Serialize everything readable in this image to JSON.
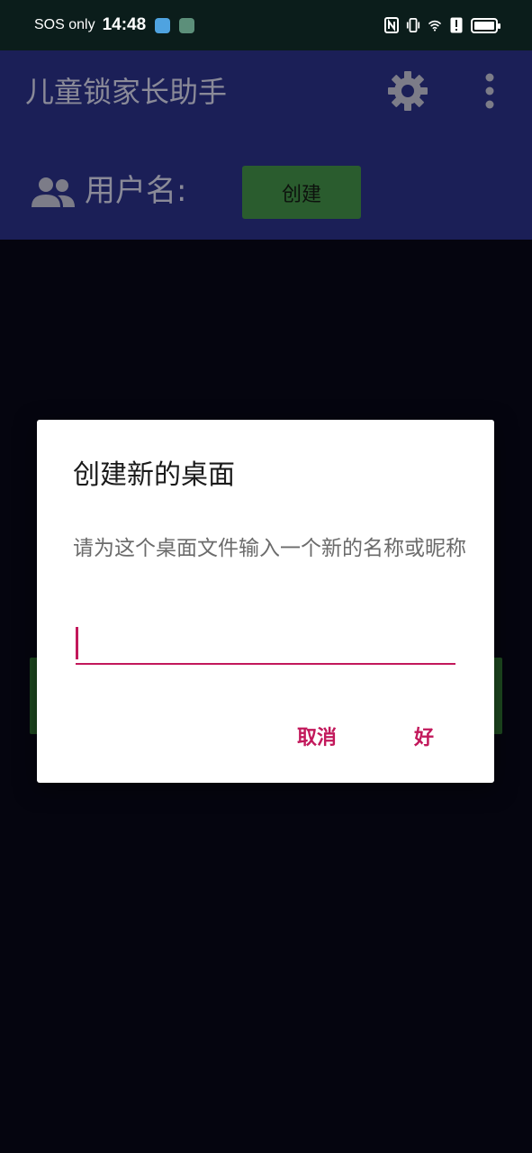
{
  "status_bar": {
    "carrier": "SOS only",
    "time": "14:48",
    "icons": [
      "weather-app-icon",
      "person-app-icon",
      "nfc-icon",
      "vibrate-icon",
      "wifi-icon",
      "alert-icon",
      "battery-icon"
    ]
  },
  "app": {
    "title": "儿童锁家长助手",
    "settings_icon": "gear-icon",
    "menu_icon": "more-vert-icon",
    "username_label": "用户名:",
    "create_button": "创建"
  },
  "dialog": {
    "title": "创建新的桌面",
    "message": "请为这个桌面文件输入一个新的名称或昵称",
    "input_value": "",
    "cancel_label": "取消",
    "ok_label": "好"
  },
  "colors": {
    "accent": "#c2185b",
    "header_bg": "#1b1f57",
    "status_bg": "#0b1d1b",
    "create_button_bg": "#2a5c2e"
  }
}
